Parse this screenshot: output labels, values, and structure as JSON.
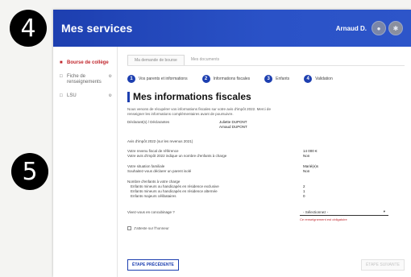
{
  "annotations": {
    "step4": "4",
    "step5": "5"
  },
  "header": {
    "title": "Mes services",
    "user_name": "Arnaud D.",
    "avatar1": "",
    "avatar2": ""
  },
  "sidebar": {
    "items": [
      {
        "label": "Bourse de collège",
        "badge": ""
      },
      {
        "label": "Fiche de renseignements",
        "badge": ""
      },
      {
        "label": "LSU",
        "badge": ""
      }
    ]
  },
  "tabs": [
    {
      "label": "Ma demande de bourse"
    },
    {
      "label": "Mes documents"
    }
  ],
  "stepper": [
    {
      "num": "1",
      "label": "Vos parents et informations"
    },
    {
      "num": "2",
      "label": "Informations fiscales"
    },
    {
      "num": "3",
      "label": "Enfants"
    },
    {
      "num": "4",
      "label": "Validation"
    }
  ],
  "page": {
    "title": "Mes informations fiscales",
    "intro": "Nous venons de récupérer vos informations fiscales sur votre avis d'impôt 2022. Merci de renseigner les informations complémentaires avant de poursuivre."
  },
  "declarants": {
    "label": "Déclarant(s) / Déclarantes",
    "names": [
      "Juliette DUPONT",
      "Arnaud DUPONT"
    ]
  },
  "tax_notice": "Avis d'impôt 2022 (sur les revenus 2021)",
  "income": [
    {
      "k": "Votre revenu fiscal de référence",
      "v": "14 000 €"
    },
    {
      "k": "Votre avis d'impôt 2022 indique un nombre d'enfants à charge",
      "v": "Non"
    }
  ],
  "family": [
    {
      "k": "Votre situation familiale",
      "v": "Marié(e)s"
    },
    {
      "k": "Souhaitez-vous déclarer un parent isolé",
      "v": "Non"
    }
  ],
  "children": {
    "title": "Nombre d'enfants à votre charge",
    "rows": [
      {
        "k": "Enfants mineurs ou handicapés en résidence exclusive",
        "v": "2"
      },
      {
        "k": "Enfants mineurs ou handicapés en résidence alternée",
        "v": "1"
      },
      {
        "k": "Enfants majeurs célibataires",
        "v": "0"
      }
    ]
  },
  "rfr": {
    "question": "Vivez-vous en concubinage ?",
    "select_value": "- Sélectionnez -",
    "hint": "Ce renseignement est obligatoire"
  },
  "checkbox_label": "J'atteste sur l'honneur",
  "actions": {
    "prev": "ÉTAPE PRÉCÉDENTE",
    "next": "ÉTAPE SUIVANTE"
  }
}
